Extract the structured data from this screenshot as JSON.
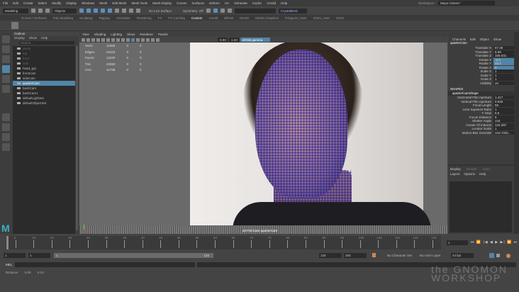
{
  "menubar": [
    "File",
    "Edit",
    "Create",
    "Select",
    "Modify",
    "Display",
    "Windows",
    "Mesh",
    "Edit Mesh",
    "Mesh Tools",
    "Mesh Display",
    "Curves",
    "Surfaces",
    "Deform",
    "UV",
    "Generate",
    "Cache",
    "Arnold",
    "Help"
  ],
  "status": {
    "mode": "Modeling",
    "objects": "Objects",
    "live_surface": "No Live Surface",
    "symmetry": "Symmetry: Off",
    "camera_select": "CrystalBretz",
    "workspace_label": "Workspace :",
    "workspace": "Maya Classic*"
  },
  "shelf_tabs": [
    "Curves / Surfaces",
    "Poly Modeling",
    "Sculpting",
    "Rigging",
    "Animation",
    "Rendering",
    "FX",
    "FX Caching",
    "Custom",
    "Arnold",
    "Bifrost",
    "MASH",
    "Motion Graphics",
    "Polygons_User",
    "XGen_User",
    "XGen"
  ],
  "shelf_active": "Custom",
  "outliner": {
    "title": "Outliner",
    "menu": [
      "Display",
      "Show",
      "Help"
    ],
    "search_placeholder": "Search...",
    "items": [
      {
        "label": "persp",
        "dim": true
      },
      {
        "label": "top",
        "dim": true
      },
      {
        "label": "front",
        "dim": true
      },
      {
        "label": "side",
        "dim": true
      },
      {
        "label": "head_grp",
        "dim": false
      },
      {
        "label": "frontCam",
        "dim": false
      },
      {
        "label": "sideCam",
        "dim": false
      },
      {
        "label": "quarterCam",
        "dim": false,
        "selected": true
      },
      {
        "label": "backCam",
        "dim": false
      },
      {
        "label": "backCam1",
        "dim": false
      },
      {
        "label": "defaultLightSet",
        "dim": false
      },
      {
        "label": "defaultObjectSet",
        "dim": false
      }
    ]
  },
  "viewport": {
    "menu": [
      "View",
      "Shading",
      "Lighting",
      "Show",
      "Renderer",
      "Panels"
    ],
    "exposure": "0.00",
    "gamma": "1.00",
    "colorspace": "sRGB gamma",
    "hud": [
      [
        "Verts:",
        "11586",
        "0",
        "0"
      ],
      [
        "Edges:",
        "23115",
        "0",
        "0"
      ],
      [
        "Faces:",
        "11530",
        "0",
        "0"
      ],
      [
        "Tris:",
        "23060",
        "0",
        "0"
      ],
      [
        "UVs:",
        "11798",
        "0",
        "0"
      ]
    ],
    "camera_label": "40 FishCam  quarterCam"
  },
  "channel_box": {
    "menu": [
      "Channels",
      "Edit",
      "Object",
      "Show"
    ],
    "object": "quarterCam",
    "attrs": [
      [
        "Translate X",
        "67.49",
        false
      ],
      [
        "Translate Y",
        "6.99",
        false
      ],
      [
        "Translate Z",
        "105.031",
        false
      ],
      [
        "Rotate X",
        "-2.4",
        true
      ],
      [
        "Rotate Y",
        "32.4",
        true
      ],
      [
        "Rotate Z",
        "0",
        true
      ],
      [
        "Scale X",
        "1",
        false
      ],
      [
        "Scale Y",
        "1",
        false
      ],
      [
        "Scale Z",
        "1",
        false
      ],
      [
        "Visibility",
        "on",
        false
      ]
    ],
    "shapes_label": "SHAPES",
    "shape": "quarterCamShape",
    "shape_attrs": [
      [
        "Horizontal Film Aperture",
        "1.417"
      ],
      [
        "Vertical Film Aperture",
        "0.945"
      ],
      [
        "Focal Length",
        "55"
      ],
      [
        "Lens Squeeze Ratio",
        "1"
      ],
      [
        "F Stop",
        "5.6"
      ],
      [
        "Focus Distance",
        "5"
      ],
      [
        "Shutter Angle",
        "144"
      ],
      [
        "Center Of Interest",
        "124.397"
      ],
      [
        "Locator Scale",
        "1"
      ],
      [
        "Motion Blur Override",
        "Use Glob..."
      ]
    ]
  },
  "layer_editor": {
    "tabs": [
      "Display",
      "Render",
      "Anim"
    ],
    "menu": [
      "Layers",
      "Options",
      "Help"
    ]
  },
  "timeline": {
    "ticks": [
      "5",
      "10",
      "15",
      "20",
      "25",
      "30",
      "35",
      "40",
      "45",
      "50",
      "55",
      "60",
      "65",
      "70",
      "75",
      "80",
      "85",
      "90",
      "95",
      "100",
      "105",
      "110",
      "115",
      "120"
    ],
    "current_frame": "1"
  },
  "range": {
    "start": "1",
    "anim_start": "1",
    "slider_start": "1",
    "slider_end": "120",
    "end": "120",
    "anim_end": "200",
    "char_set": "No Character Set",
    "anim_layer": "No Anim Layer",
    "fps": "24 fps"
  },
  "mel": {
    "label": "MEL"
  },
  "help_line": {
    "label": "Distance",
    "v1": "0.00",
    "v2": "0.10"
  },
  "watermark": {
    "line1": "the GNOMON",
    "line2": "WORKSHOP"
  }
}
